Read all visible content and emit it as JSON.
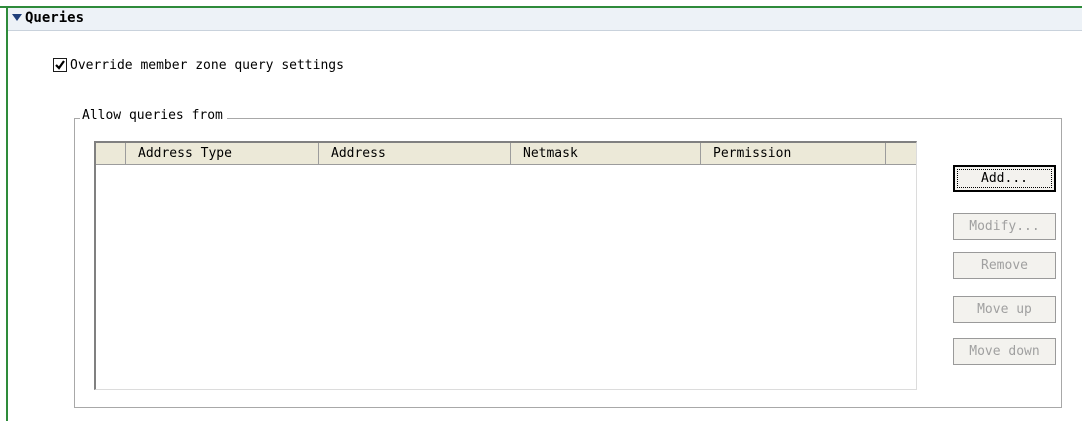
{
  "section": {
    "title": "Queries"
  },
  "override": {
    "label": "Override member zone query settings",
    "checked": true
  },
  "allow_group": {
    "legend": "Allow queries from"
  },
  "table": {
    "columns": [
      "Address Type",
      "Address",
      "Netmask",
      "Permission"
    ],
    "rows": []
  },
  "buttons": {
    "add": "Add...",
    "modify": "Modify...",
    "remove": "Remove",
    "move_up": "Move up",
    "move_down": "Move down"
  },
  "colors": {
    "frame": "#2e8b3a",
    "header_bg": "#edf2f7",
    "disabled_text": "#a0a0a0"
  }
}
